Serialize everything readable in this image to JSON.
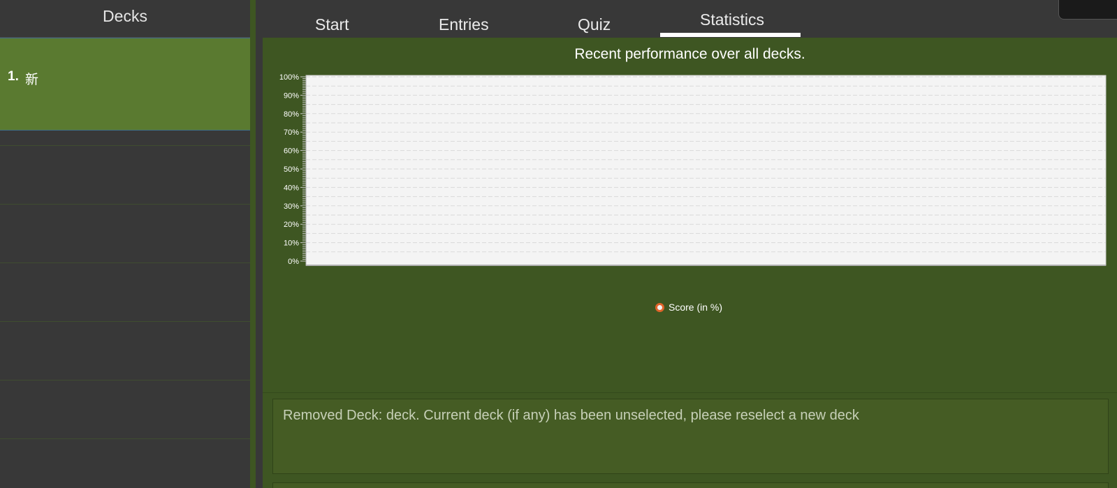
{
  "deck_panel": {
    "header": "Decks",
    "decks": [
      {
        "index": "1.",
        "name": "新"
      }
    ]
  },
  "tabs": {
    "items": [
      "Start",
      "Entries",
      "Quiz",
      "Statistics"
    ],
    "selected": "Statistics"
  },
  "chart_data": {
    "type": "line",
    "title": "Recent performance over all decks.",
    "y_tick_labels": [
      "100%",
      "90%",
      "80%",
      "70%",
      "60%",
      "50%",
      "40%",
      "30%",
      "20%",
      "10%",
      "0%"
    ],
    "ylim": [
      0,
      100
    ],
    "grid": true,
    "series": [
      {
        "name": "Score (in %)",
        "values": [],
        "color": "#e0642a"
      }
    ],
    "legend_position": "bottom-center"
  },
  "result_display": {
    "text": "Removed Deck: deck. Current deck (if any) has been unselected, please reselect a new deck"
  },
  "colors": {
    "accent_green": "#5a7a30",
    "panel_green": "#3e5622",
    "dark_bg": "#383838",
    "series_orange": "#e0642a"
  }
}
